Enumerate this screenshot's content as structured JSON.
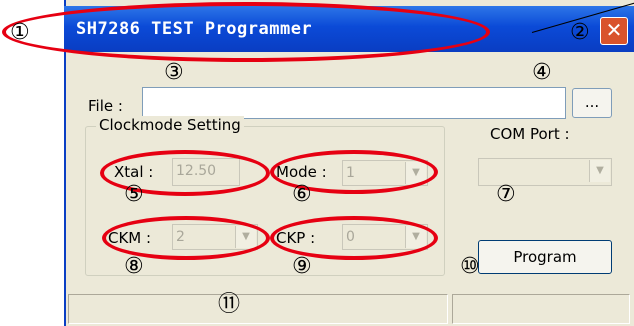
{
  "window": {
    "title": "SH7286 TEST Programmer",
    "close_glyph": "✕"
  },
  "file": {
    "label": "File :",
    "value": "",
    "browse_label": "..."
  },
  "clock": {
    "group_title": "Clockmode Setting",
    "xtal_label": "Xtal :",
    "xtal_value": "12.50",
    "mode_label": "Mode :",
    "mode_value": "1",
    "ckm_label": "CKM :",
    "ckm_value": "2",
    "ckp_label": "CKP :",
    "ckp_value": "0"
  },
  "com": {
    "label": "COM Port :",
    "value": ""
  },
  "program_label": "Program",
  "annotations": {
    "n1": "①",
    "n2": "②",
    "n3": "③",
    "n4": "④",
    "n5": "⑤",
    "n6": "⑥",
    "n7": "⑦",
    "n8": "⑧",
    "n9": "⑨",
    "n10": "⑩",
    "n11": "⑪",
    "color": "#e60012"
  }
}
